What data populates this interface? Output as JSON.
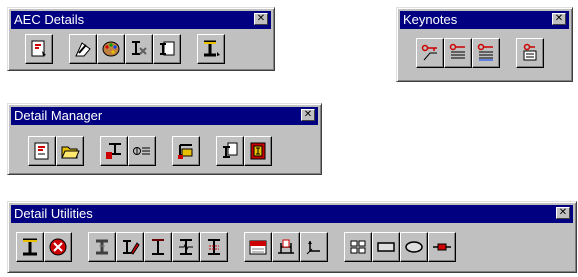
{
  "toolbars": {
    "aec_details": {
      "title": "AEC Details",
      "close_glyph": "✕"
    },
    "keynotes": {
      "title": "Keynotes",
      "close_glyph": "✕"
    },
    "detail_manager": {
      "title": "Detail Manager",
      "close_glyph": "✕"
    },
    "detail_utilities": {
      "title": "Detail Utilities",
      "close_glyph": "✕"
    }
  },
  "icons": {
    "aec_details": [
      "detail-component-icon",
      "edit-detail-icon",
      "palette-icon",
      "detail-properties-icon",
      "insert-detail-icon",
      "beam-detail-icon"
    ],
    "keynotes": [
      "keynote-leader-icon",
      "keynote-list-icon",
      "keynote-sheet-icon",
      "keynote-legend-icon"
    ],
    "detail_manager": [
      "new-detail-icon",
      "open-folder-icon",
      "detail-tag-icon",
      "detail-callout-icon",
      "detail-palette-icon",
      "detail-copy-icon",
      "detail-book-icon"
    ],
    "detail_utilities": [
      "section-beam-icon",
      "delete-detail-icon",
      "tee-section-icon",
      "draw-beam-icon",
      "i-beam-icon",
      "break-line-icon",
      "hatch-beam-icon",
      "hatch-rect-icon",
      "box-outline-icon",
      "corner-leader-icon",
      "grid-array-icon",
      "rectangle-icon",
      "ellipse-icon",
      "batt-insulation-icon"
    ]
  },
  "colors": {
    "titlebar": "#000080",
    "face": "#c0c0c0",
    "accent_red": "#cc0000",
    "accent_yellow": "#e8c000"
  }
}
